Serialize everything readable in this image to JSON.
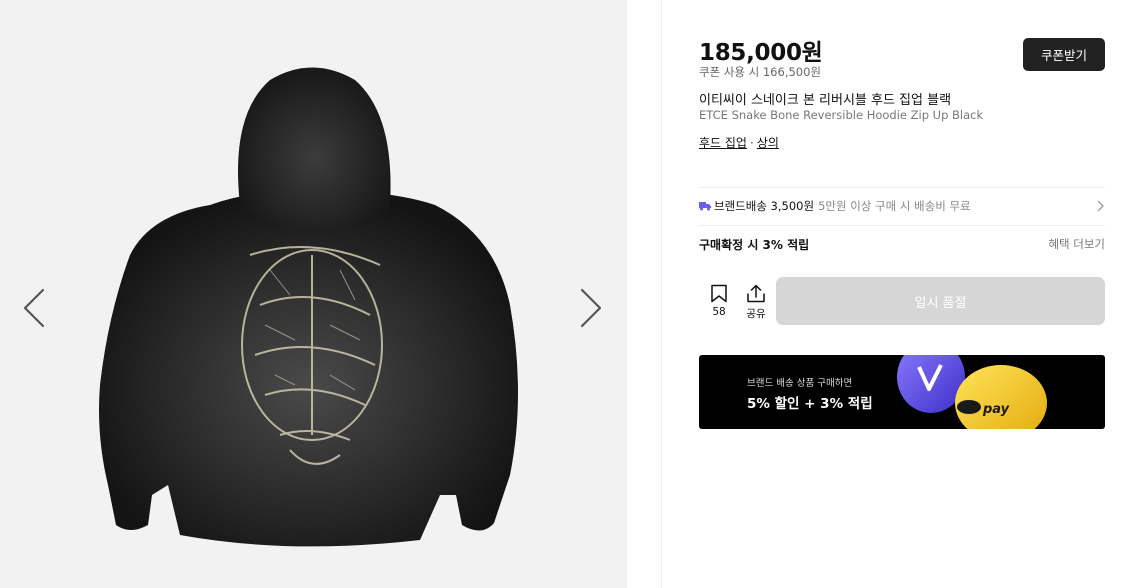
{
  "gallery": {
    "prev_icon": "chevron-left-icon",
    "next_icon": "chevron-right-icon",
    "image_alt": "hoodie back view"
  },
  "product": {
    "price": "185,000원",
    "coupon_price": "쿠폰 사용 시 166,500원",
    "coupon_button": "쿠폰받기",
    "title_kr": "이티씨이 스네이크 본 리버시블 후드 집업 블랙",
    "title_en": "ETCE Snake Bone Reversible Hoodie Zip Up Black",
    "categories": [
      "후드 집업",
      "상의"
    ],
    "category_separator": "·"
  },
  "shipping": {
    "icon": "truck-icon",
    "label": "브랜드배송 3,500원",
    "free_condition": "5만원 이상 구매 시 배송비 무료"
  },
  "points": {
    "label": "구매확정 시 3% 적립",
    "benefit_link": "혜택 더보기"
  },
  "actions": {
    "bookmark_count": "58",
    "share_label": "공유",
    "soldout_label": "일시 품절"
  },
  "banner": {
    "subtitle": "브랜드 배송 상품 구매하면",
    "headline": "5% 할인 + 3% 적립",
    "pay_label": "pay"
  },
  "colors": {
    "dark_button": "#222222",
    "soldout_bg": "#d6d6d6",
    "truck_accent": "#6a5cf5",
    "banner_bg": "#000000",
    "coin_purple": "#5b4fe8",
    "coin_yellow": "#f6d21c"
  }
}
